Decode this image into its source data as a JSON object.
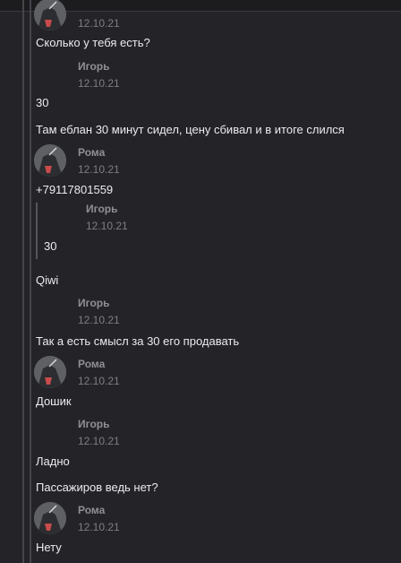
{
  "messages": [
    {
      "date": "12.10.21"
    },
    {
      "text": "Сколько у тебя есть?"
    },
    {
      "name": "Игорь",
      "date": "12.10.21"
    },
    {
      "text": "30"
    },
    {
      "text": "Там еблан 30 минут сидел, цену сбивал и в итоге слился"
    },
    {
      "name": "Рома",
      "date": "12.10.21"
    },
    {
      "text": "+79117801559"
    },
    {
      "name": "Игорь",
      "date": "12.10.21"
    },
    {
      "text": "30"
    },
    {
      "text": "Qiwi"
    },
    {
      "name": "Игорь",
      "date": "12.10.21"
    },
    {
      "text": "Так а есть смысл за 30 его продавать"
    },
    {
      "name": "Рома",
      "date": "12.10.21"
    },
    {
      "text": "Дошик"
    },
    {
      "name": "Игорь",
      "date": "12.10.21"
    },
    {
      "text": "Ладно"
    },
    {
      "text": "Пассажиров ведь нет?"
    },
    {
      "name": "Рома",
      "date": "12.10.21"
    },
    {
      "text": "Нету"
    }
  ]
}
